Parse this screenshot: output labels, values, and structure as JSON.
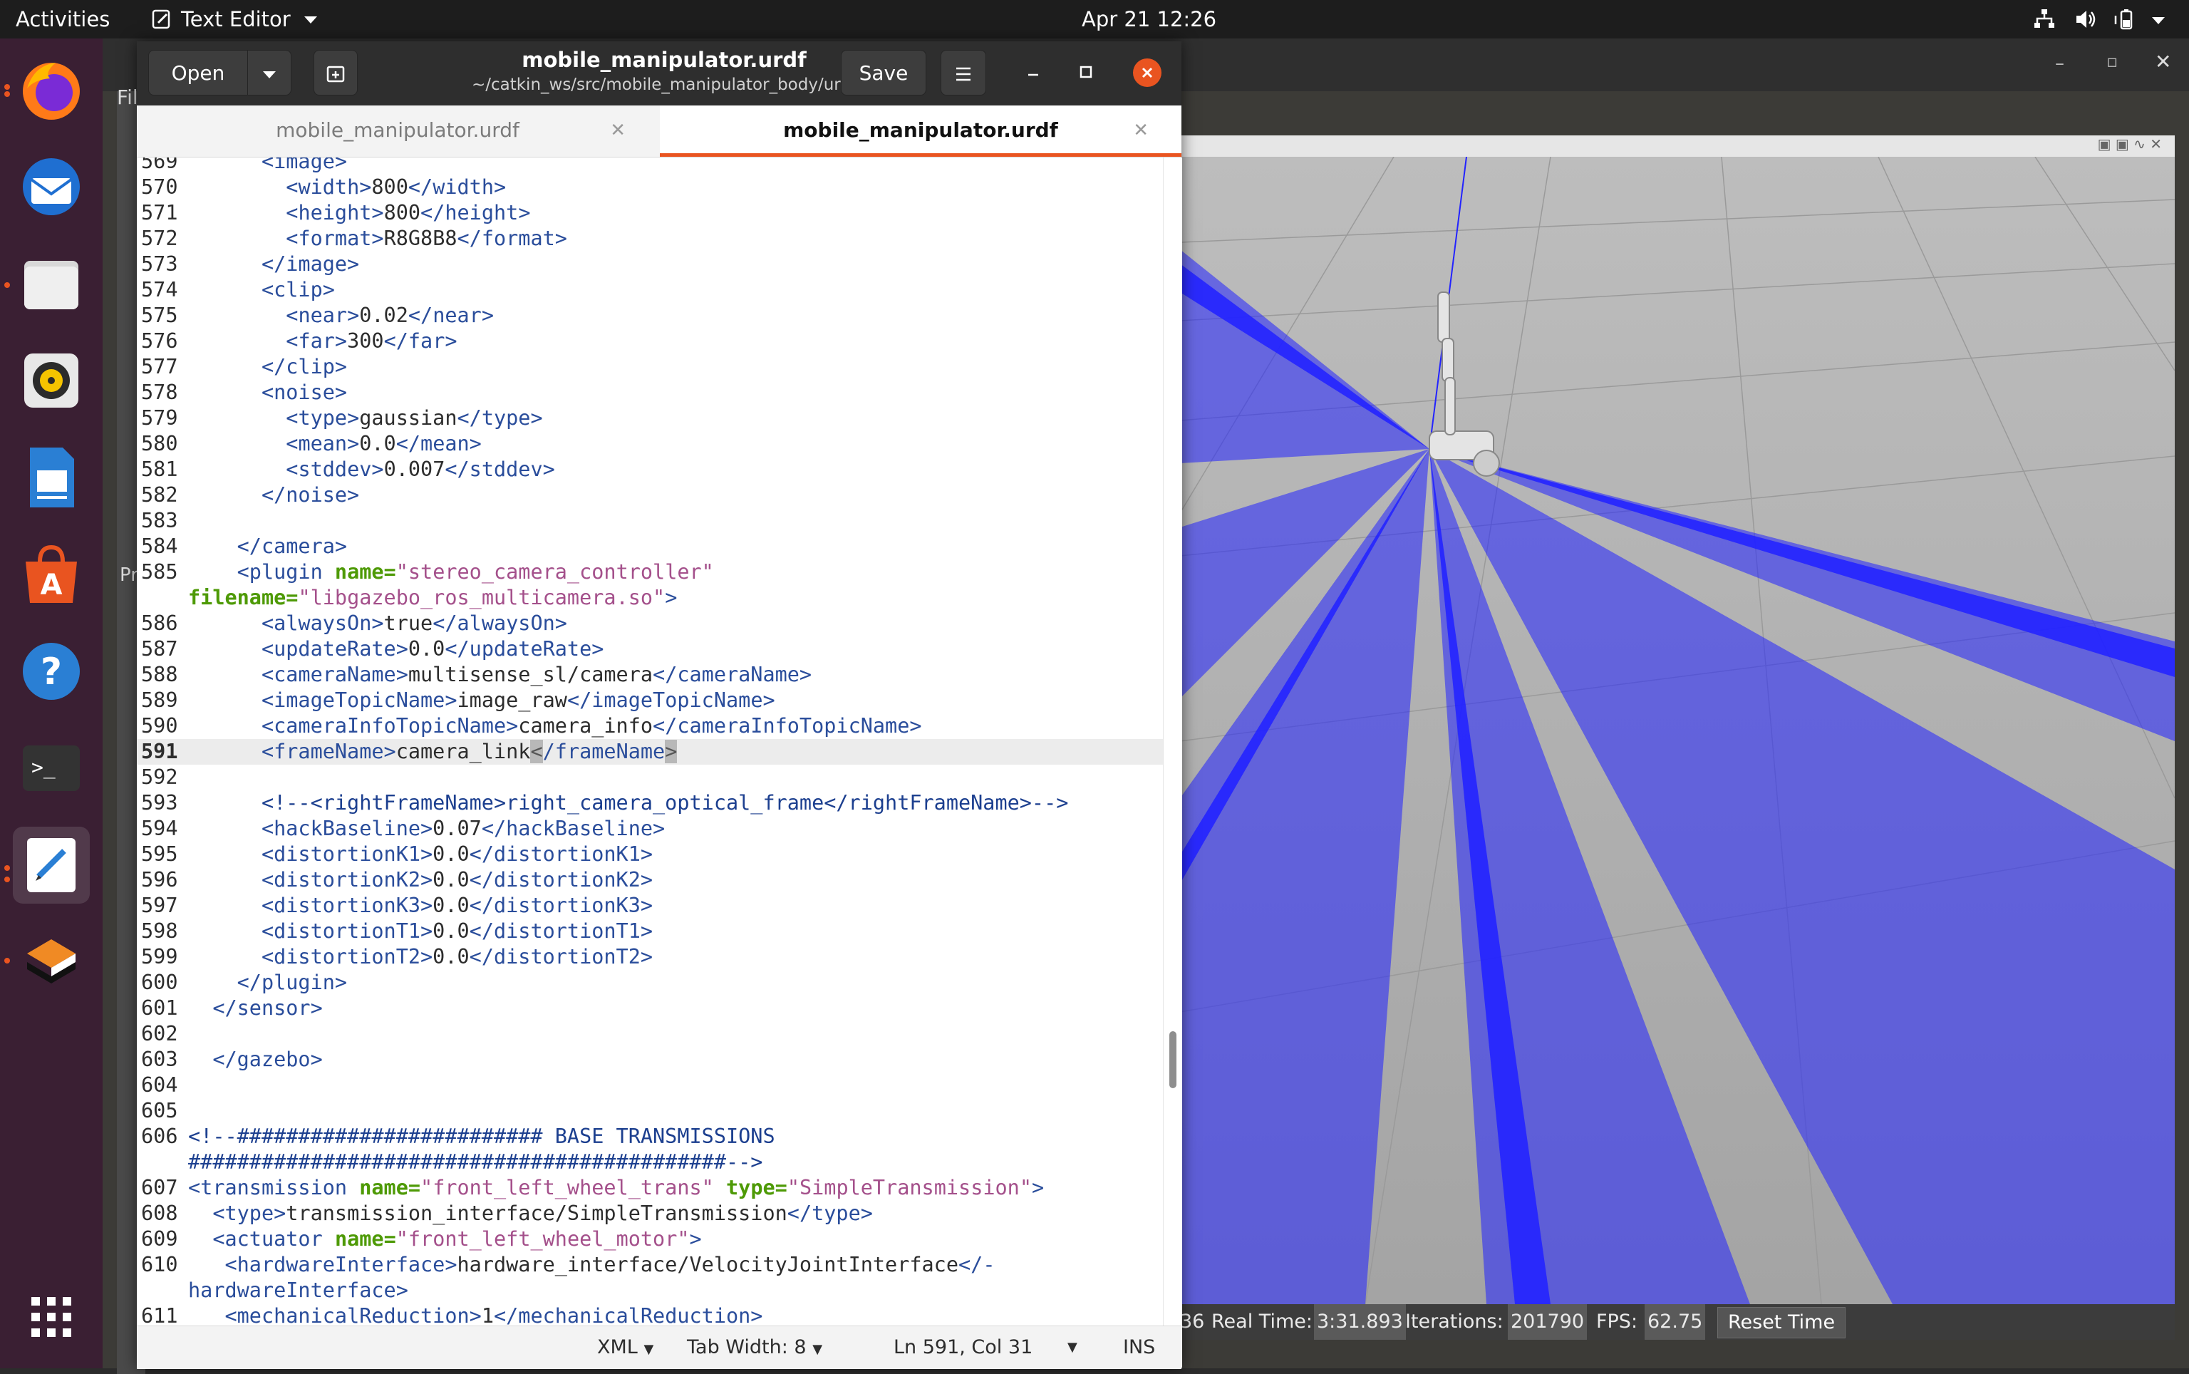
{
  "topbar": {
    "activities": "Activities",
    "app_name": "Text Editor",
    "clock": "Apr 21  12:26"
  },
  "dock": {
    "apps": [
      "firefox-icon",
      "thunderbird-icon",
      "files-icon",
      "rhythmbox-icon",
      "libreoffice-writer-icon",
      "software-center-icon",
      "help-icon",
      "terminal-icon",
      "text-editor-icon",
      "app-icon",
      "show-apps-icon"
    ]
  },
  "editor": {
    "open_label": "Open",
    "save_label": "Save",
    "title": "mobile_manipulator.urdf",
    "subtitle": "~/catkin_ws/src/mobile_manipulator_body/urdf",
    "tabs": [
      {
        "label": "mobile_manipulator.urdf",
        "active": false
      },
      {
        "label": "mobile_manipulator.urdf",
        "active": true
      }
    ],
    "status": {
      "language": "XML",
      "tab_width": "Tab Width: 8",
      "position": "Ln 591, Col 31",
      "mode": "INS"
    }
  },
  "code_lines": [
    {
      "n": "569",
      "html": "      <span class=\"t\">&lt;image&gt;</span>"
    },
    {
      "n": "570",
      "html": "        <span class=\"t\">&lt;width&gt;</span>800<span class=\"t\">&lt;/width&gt;</span>"
    },
    {
      "n": "571",
      "html": "        <span class=\"t\">&lt;height&gt;</span>800<span class=\"t\">&lt;/height&gt;</span>"
    },
    {
      "n": "572",
      "html": "        <span class=\"t\">&lt;format&gt;</span>R8G8B8<span class=\"t\">&lt;/format&gt;</span>"
    },
    {
      "n": "573",
      "html": "      <span class=\"t\">&lt;/image&gt;</span>"
    },
    {
      "n": "574",
      "html": "      <span class=\"t\">&lt;clip&gt;</span>"
    },
    {
      "n": "575",
      "html": "        <span class=\"t\">&lt;near&gt;</span>0.02<span class=\"t\">&lt;/near&gt;</span>"
    },
    {
      "n": "576",
      "html": "        <span class=\"t\">&lt;far&gt;</span>300<span class=\"t\">&lt;/far&gt;</span>"
    },
    {
      "n": "577",
      "html": "      <span class=\"t\">&lt;/clip&gt;</span>"
    },
    {
      "n": "578",
      "html": "      <span class=\"t\">&lt;noise&gt;</span>"
    },
    {
      "n": "579",
      "html": "        <span class=\"t\">&lt;type&gt;</span>gaussian<span class=\"t\">&lt;/type&gt;</span>"
    },
    {
      "n": "580",
      "html": "        <span class=\"t\">&lt;mean&gt;</span>0.0<span class=\"t\">&lt;/mean&gt;</span>"
    },
    {
      "n": "581",
      "html": "        <span class=\"t\">&lt;stddev&gt;</span>0.007<span class=\"t\">&lt;/stddev&gt;</span>"
    },
    {
      "n": "582",
      "html": "      <span class=\"t\">&lt;/noise&gt;</span>"
    },
    {
      "n": "583",
      "html": ""
    },
    {
      "n": "584",
      "html": "    <span class=\"t\">&lt;/camera&gt;</span>"
    },
    {
      "n": "585",
      "html": "    <span class=\"t\">&lt;plugin</span> <span class=\"a\">name=</span><span class=\"s\">\"stereo_camera_controller\"</span>"
    },
    {
      "n": "",
      "html": "<span class=\"a\">filename=</span><span class=\"s\">\"libgazebo_ros_multicamera.so\"</span><span class=\"t\">&gt;</span>"
    },
    {
      "n": "586",
      "html": "      <span class=\"t\">&lt;alwaysOn&gt;</span>true<span class=\"t\">&lt;/alwaysOn&gt;</span>"
    },
    {
      "n": "587",
      "html": "      <span class=\"t\">&lt;updateRate&gt;</span>0.0<span class=\"t\">&lt;/updateRate&gt;</span>"
    },
    {
      "n": "588",
      "html": "      <span class=\"t\">&lt;cameraName&gt;</span>multisense_sl/camera<span class=\"t\">&lt;/cameraName&gt;</span>"
    },
    {
      "n": "589",
      "html": "      <span class=\"t\">&lt;imageTopicName&gt;</span>image_raw<span class=\"t\">&lt;/imageTopicName&gt;</span>"
    },
    {
      "n": "590",
      "html": "      <span class=\"t\">&lt;cameraInfoTopicName&gt;</span>camera_info<span class=\"t\">&lt;/cameraInfoTopicName&gt;</span>"
    },
    {
      "n": "591",
      "html": "      <span class=\"t\">&lt;frameName&gt;</span>camera_link<span class=\"hl\">&lt;</span><span class=\"t\">/frameName</span><span class=\"hl\">&gt;</span>",
      "current": true
    },
    {
      "n": "592",
      "html": ""
    },
    {
      "n": "593",
      "html": "      <span class=\"c\">&lt;!--&lt;rightFrameName&gt;right_camera_optical_frame&lt;/rightFrameName&gt;--&gt;</span>"
    },
    {
      "n": "594",
      "html": "      <span class=\"t\">&lt;hackBaseline&gt;</span>0.07<span class=\"t\">&lt;/hackBaseline&gt;</span>"
    },
    {
      "n": "595",
      "html": "      <span class=\"t\">&lt;distortionK1&gt;</span>0.0<span class=\"t\">&lt;/distortionK1&gt;</span>"
    },
    {
      "n": "596",
      "html": "      <span class=\"t\">&lt;distortionK2&gt;</span>0.0<span class=\"t\">&lt;/distortionK2&gt;</span>"
    },
    {
      "n": "597",
      "html": "      <span class=\"t\">&lt;distortionK3&gt;</span>0.0<span class=\"t\">&lt;/distortionK3&gt;</span>"
    },
    {
      "n": "598",
      "html": "      <span class=\"t\">&lt;distortionT1&gt;</span>0.0<span class=\"t\">&lt;/distortionT1&gt;</span>"
    },
    {
      "n": "599",
      "html": "      <span class=\"t\">&lt;distortionT2&gt;</span>0.0<span class=\"t\">&lt;/distortionT2&gt;</span>"
    },
    {
      "n": "600",
      "html": "    <span class=\"t\">&lt;/plugin&gt;</span>"
    },
    {
      "n": "601",
      "html": "  <span class=\"t\">&lt;/sensor&gt;</span>"
    },
    {
      "n": "602",
      "html": ""
    },
    {
      "n": "603",
      "html": "  <span class=\"t\">&lt;/gazebo&gt;</span>"
    },
    {
      "n": "604",
      "html": ""
    },
    {
      "n": "605",
      "html": ""
    },
    {
      "n": "606",
      "html": "<span class=\"c\">&lt;!--######################### BASE TRANSMISSIONS</span>"
    },
    {
      "n": "",
      "html": "<span class=\"c\">############################################--&gt;</span>"
    },
    {
      "n": "607",
      "html": "<span class=\"t\">&lt;transmission</span> <span class=\"a\">name=</span><span class=\"s\">\"front_left_wheel_trans\"</span> <span class=\"a\">type=</span><span class=\"s\">\"SimpleTransmission\"</span><span class=\"t\">&gt;</span>"
    },
    {
      "n": "608",
      "html": "  <span class=\"t\">&lt;type&gt;</span>transmission_interface/SimpleTransmission<span class=\"t\">&lt;/type&gt;</span>"
    },
    {
      "n": "609",
      "html": "  <span class=\"t\">&lt;actuator</span> <span class=\"a\">name=</span><span class=\"s\">\"front_left_wheel_motor\"</span><span class=\"t\">&gt;</span>"
    },
    {
      "n": "610",
      "html": "   <span class=\"t\">&lt;hardwareInterface&gt;</span>hardware_interface/VelocityJointInterface<span class=\"t\">&lt;/-</span>"
    },
    {
      "n": "",
      "html": "<span class=\"t\">hardwareInterface&gt;</span>"
    },
    {
      "n": "611",
      "html": "   <span class=\"t\">&lt;mechanicalReduction&gt;</span>1<span class=\"t\">&lt;/mechanicalReduction&gt;</span>"
    }
  ],
  "gazebo": {
    "sim_time_tail": "36",
    "real_time_label": "Real Time:",
    "real_time_value": "3:31.893",
    "iterations_label": "Iterations:",
    "iterations_value": "201790",
    "fps_label": "FPS:",
    "fps_value": "62.75",
    "reset_label": "Reset Time",
    "menu_fragment": "Fil",
    "side_fragment": "Pr"
  },
  "colors": {
    "accent": "#e95420",
    "laser": "#2323ff"
  }
}
